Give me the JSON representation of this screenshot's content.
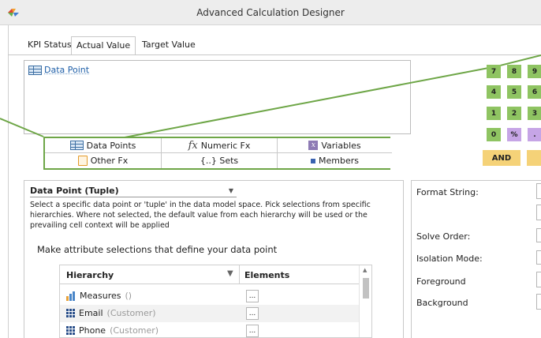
{
  "window": {
    "title": "Advanced Calculation Designer"
  },
  "tabs": [
    "KPI Status",
    "Actual Value",
    "Target Value"
  ],
  "formula": {
    "token_label": "Data Point"
  },
  "insert_buttons": {
    "data_points": "Data Points",
    "numeric_fx": "Numeric Fx",
    "variables": "Variables",
    "other_fx": "Other Fx",
    "sets": "{..} Sets",
    "members": "Members"
  },
  "keypad": {
    "keys": [
      "7",
      "8",
      "9",
      "4",
      "5",
      "6",
      "1",
      "2",
      "3",
      "0",
      "%",
      "."
    ],
    "and_label": "AND"
  },
  "data_point_panel": {
    "type_selected": "Data Point (Tuple)",
    "description": "Select a specific data point or 'tuple' in the data model space. Pick selections from specific hierarchies. Where not selected, the default value from each hierarchy will be used or the prevailing cell context will be applied",
    "instruction": "Make attribute selections that define your data point",
    "columns": {
      "hierarchy": "Hierarchy",
      "elements": "Elements"
    },
    "rows": [
      {
        "name": "Measures",
        "qualifier": "()",
        "icon": "bar-chart-icon"
      },
      {
        "name": "Email",
        "qualifier": "(Customer)",
        "icon": "grid-icon"
      },
      {
        "name": "Phone",
        "qualifier": "(Customer)",
        "icon": "grid-icon"
      }
    ],
    "element_button_label": "..."
  },
  "properties": {
    "format_string": "Format String:",
    "solve_order": "Solve Order:",
    "isolation_mode": "Isolation Mode:",
    "foreground": "Foreground",
    "background": "Background"
  },
  "colors": {
    "highlight_green": "#6ea647",
    "keypad_green": "#8fc462",
    "keypad_purple": "#c6a5e6",
    "keypad_yellow": "#f5d278"
  }
}
